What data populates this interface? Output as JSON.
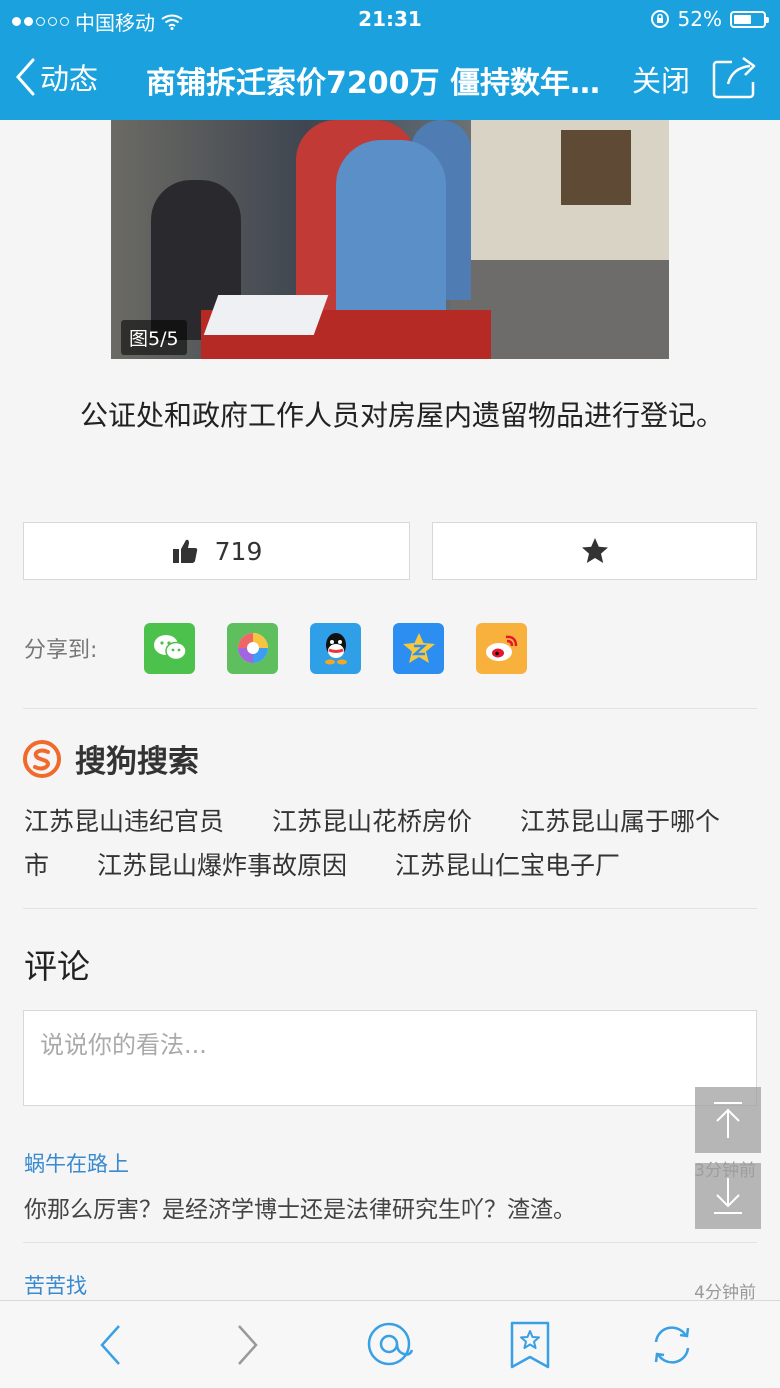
{
  "status_bar": {
    "carrier": "中国移动",
    "time": "21:31",
    "battery": "52%",
    "signal_bars": 2,
    "battery_level": 0.52
  },
  "nav": {
    "back_label": "动态",
    "title": "商铺拆迁索价7200万 僵持数年…",
    "close_label": "关闭",
    "back_icon": "chevron-left-icon",
    "share_icon": "share-icon"
  },
  "photo": {
    "counter": "图5/5"
  },
  "caption": "公证处和政府工作人员对房屋内遗留物品进行登记。",
  "actions": {
    "like_count": "719",
    "like_icon": "thumbs-up-icon",
    "favorite_icon": "star-icon"
  },
  "share": {
    "label": "分享到:",
    "targets": [
      "wechat",
      "moments",
      "qq",
      "qzone",
      "weibo"
    ]
  },
  "sogou": {
    "brand": "搜狗搜索",
    "keywords": [
      "江苏昆山违纪官员",
      "江苏昆山花桥房价",
      "江苏昆山属于哪个市",
      "江苏昆山爆炸事故原因",
      "江苏昆山仁宝电子厂"
    ]
  },
  "comments": {
    "title": "评论",
    "placeholder": "说说你的看法...",
    "items": [
      {
        "user": "蜗牛在路上",
        "time": "3分钟前",
        "text": "你那么厉害？是经济学博士还是法律研究生吖？渣渣。"
      },
      {
        "user": "苦苦找",
        "time": "4分钟前",
        "text": ""
      }
    ]
  },
  "colors": {
    "header_blue": "#1ba1de",
    "link_blue": "#3a8ad0",
    "sogou_orange": "#f06a2b"
  }
}
